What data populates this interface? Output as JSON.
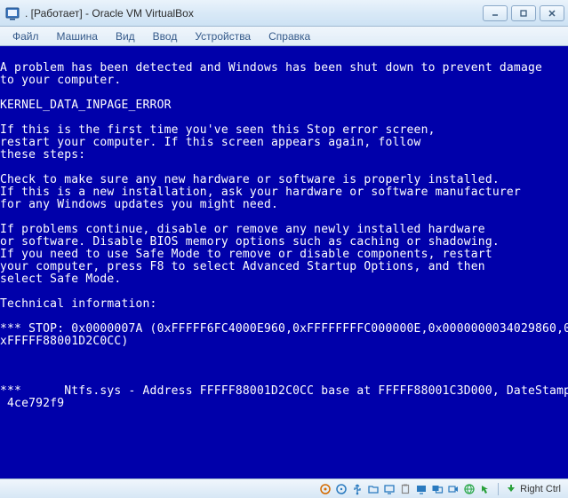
{
  "window": {
    "title": ". [Работает] - Oracle VM VirtualBox"
  },
  "menu": {
    "items": [
      {
        "label": "Файл"
      },
      {
        "label": "Машина"
      },
      {
        "label": "Вид"
      },
      {
        "label": "Ввод"
      },
      {
        "label": "Устройства"
      },
      {
        "label": "Справка"
      }
    ]
  },
  "bsod": {
    "lines": [
      "",
      "A problem has been detected and Windows has been shut down to prevent damage",
      "to your computer.",
      "",
      "KERNEL_DATA_INPAGE_ERROR",
      "",
      "If this is the first time you've seen this Stop error screen,",
      "restart your computer. If this screen appears again, follow",
      "these steps:",
      "",
      "Check to make sure any new hardware or software is properly installed.",
      "If this is a new installation, ask your hardware or software manufacturer",
      "for any Windows updates you might need.",
      "",
      "If problems continue, disable or remove any newly installed hardware",
      "or software. Disable BIOS memory options such as caching or shadowing.",
      "If you need to use Safe Mode to remove or disable components, restart",
      "your computer, press F8 to select Advanced Startup Options, and then",
      "select Safe Mode.",
      "",
      "Technical information:",
      "",
      "*** STOP: 0x0000007A (0xFFFFF6FC4000E960,0xFFFFFFFFC000000E,0x0000000034029860,0",
      "xFFFFF88001D2C0CC)",
      "",
      "",
      "",
      "***      Ntfs.sys - Address FFFFF88001D2C0CC base at FFFFF88001C3D000, DateStamp",
      " 4ce792f9"
    ]
  },
  "status": {
    "hostkey": "Right Ctrl",
    "icons": [
      "hard-disk-icon",
      "optical-disc-icon",
      "usb-icon",
      "shared-folder-icon",
      "display-icon",
      "clipboard-icon",
      "screen1-icon",
      "screen2-icon",
      "recording-icon",
      "network-icon",
      "mouse-integration-icon"
    ]
  },
  "colors": {
    "bsod_bg": "#0000aa",
    "bsod_fg": "#ffffff"
  }
}
